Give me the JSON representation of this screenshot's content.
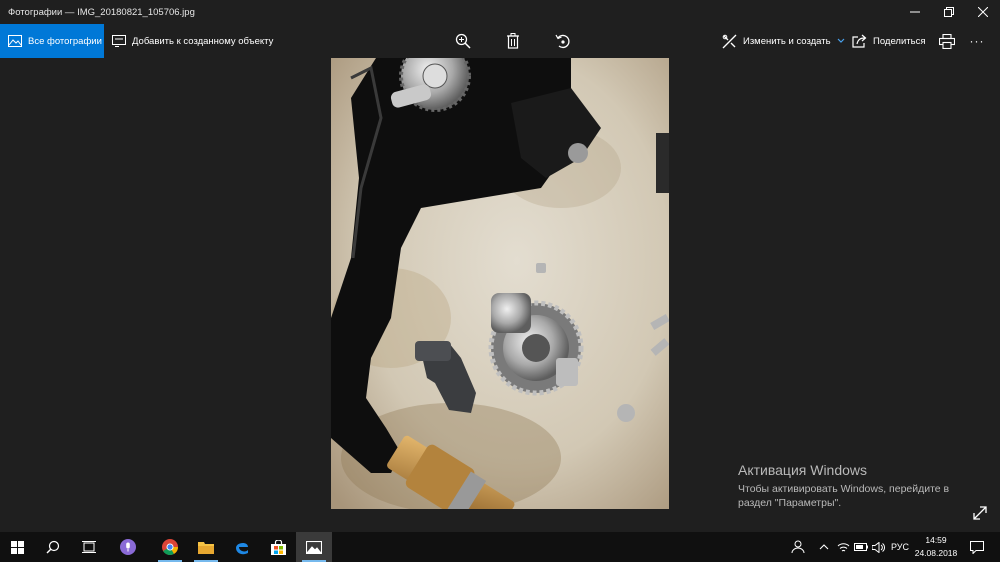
{
  "window": {
    "title": "Фотографии — IMG_20180821_105706.jpg"
  },
  "toolbar": {
    "all_photos": "Все фотографии",
    "add_to_creation": "Добавить к созданному объекту",
    "zoom_icon": "zoom-in-icon",
    "delete_icon": "trash-icon",
    "rotate_icon": "rotate-icon",
    "edit_create": "Изменить и создать",
    "share": "Поделиться",
    "print_icon": "printer-icon",
    "more": "···"
  },
  "watermark": {
    "title": "Активация Windows",
    "line1": "Чтобы активировать Windows, перейдите в",
    "line2": "раздел \"Параметры\"."
  },
  "taskbar": {
    "apps": [
      "start",
      "search",
      "task-view",
      "cortana",
      "chrome",
      "file-explorer",
      "edge",
      "store",
      "photos"
    ],
    "language": "РУС",
    "time": "14:59",
    "date": "24.08.2018"
  },
  "colors": {
    "accent": "#0078d7",
    "background": "#1f1f1f",
    "taskbar": "#101010"
  }
}
